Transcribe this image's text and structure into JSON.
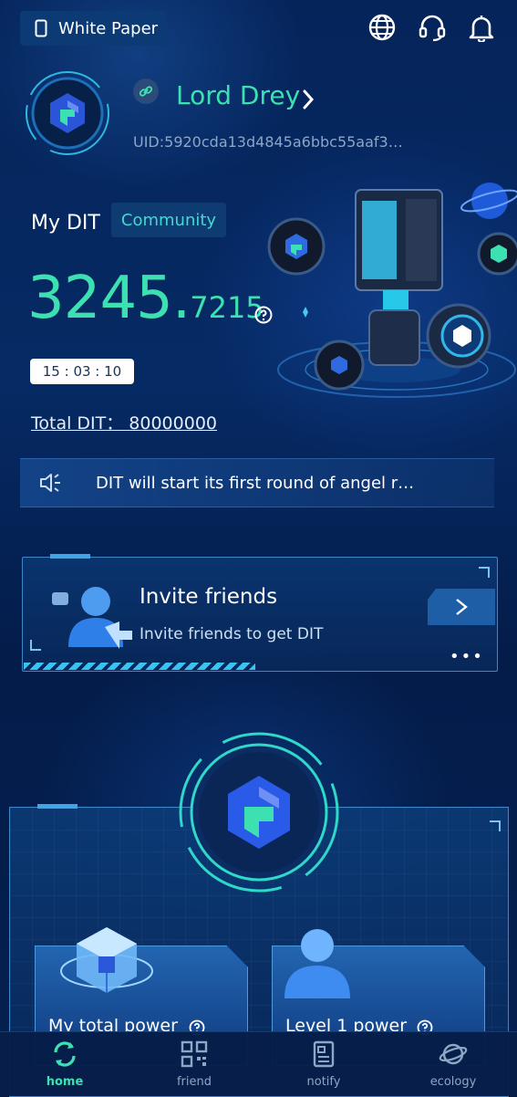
{
  "header": {
    "white_paper_label": "White Paper",
    "icons": [
      "phone-icon",
      "globe-icon",
      "headset-icon",
      "bell-icon"
    ]
  },
  "profile": {
    "username": "Lord Drey",
    "uid": "UID:5920cda13d4845a6bbc55aaf3…"
  },
  "dit": {
    "label": "My DIT",
    "community_label": "Community",
    "balance_int": "3245.",
    "balance_dec": "7215",
    "timer": "15 : 03 : 10",
    "total": "Total DIT： 80000000"
  },
  "notice": {
    "text": "DIT will start its first round of angel r…"
  },
  "invite": {
    "title": "Invite friends",
    "subtitle": "Invite friends to get DIT",
    "dots": "•••"
  },
  "power": {
    "my_total_label": "My total power",
    "level1_label": "Level 1 power"
  },
  "nav": {
    "items": [
      {
        "label": "home",
        "icon": "refresh-icon",
        "active": true
      },
      {
        "label": "friend",
        "icon": "qr-code-icon",
        "active": false
      },
      {
        "label": "notify",
        "icon": "document-icon",
        "active": false
      },
      {
        "label": "ecology",
        "icon": "planet-icon",
        "active": false
      }
    ]
  },
  "colors": {
    "accent": "#3de0b0",
    "background": "#041a45",
    "panel_border": "#3d86c8"
  }
}
